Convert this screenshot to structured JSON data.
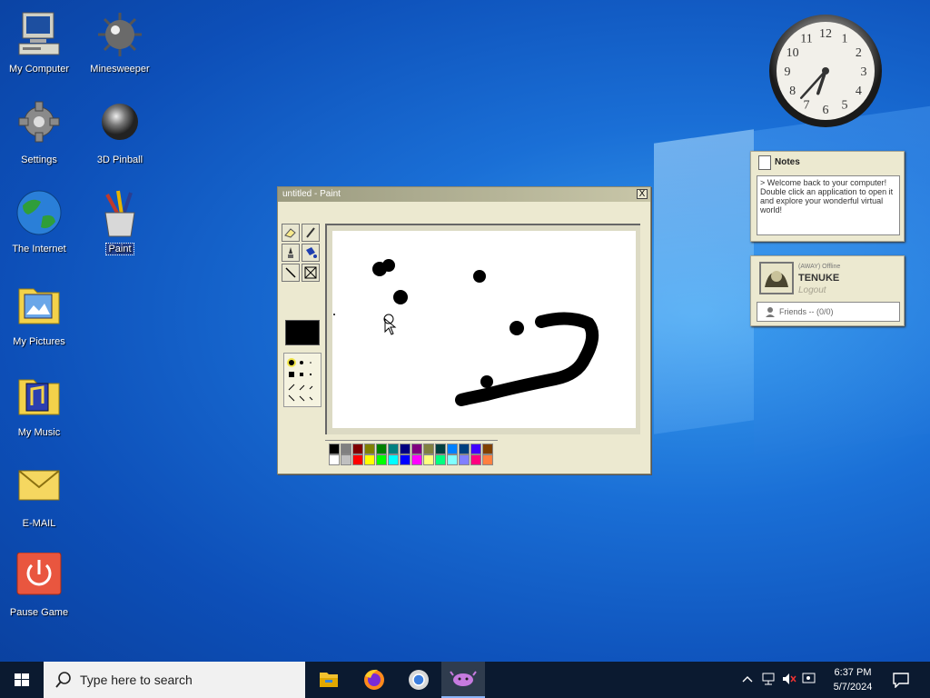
{
  "desktop": {
    "icons": [
      {
        "label": "My Computer"
      },
      {
        "label": "Minesweeper"
      },
      {
        "label": "Settings"
      },
      {
        "label": "3D Pinball"
      },
      {
        "label": "The Internet"
      },
      {
        "label": "Paint"
      },
      {
        "label": "My Pictures"
      },
      {
        "label": "My Music"
      },
      {
        "label": "E-MAIL"
      },
      {
        "label": "Pause Game"
      }
    ]
  },
  "paint": {
    "title": "untitled - Paint",
    "close": "X",
    "palette_top": [
      "#000000",
      "#808080",
      "#800000",
      "#808000",
      "#008000",
      "#008080",
      "#000080",
      "#800080",
      "#808040",
      "#004040",
      "#0080ff",
      "#004080",
      "#4000ff",
      "#804000"
    ],
    "palette_bottom": [
      "#ffffff",
      "#c0c0c0",
      "#ff0000",
      "#ffff00",
      "#00ff00",
      "#00ffff",
      "#0000ff",
      "#ff00ff",
      "#ffff80",
      "#00ff80",
      "#80ffff",
      "#8080ff",
      "#ff0080",
      "#ff8040"
    ],
    "current_color": "#000000"
  },
  "clock": {
    "numbers": [
      "12",
      "1",
      "2",
      "3",
      "4",
      "5",
      "6",
      "7",
      "8",
      "9",
      "10",
      "11"
    ],
    "hour": 6,
    "minute": 37
  },
  "notes": {
    "title": "Notes",
    "text": "> Welcome back to your computer! Double click an application to open it and explore your wonderful virtual world!"
  },
  "messenger": {
    "status": "(AWAY) Offline",
    "name": "TENUKE",
    "logout": "Logout",
    "friends": "Friends -- (0/0)"
  },
  "taskbar": {
    "search_placeholder": "Type here to search",
    "time": "6:37 PM",
    "date": "5/7/2024"
  }
}
